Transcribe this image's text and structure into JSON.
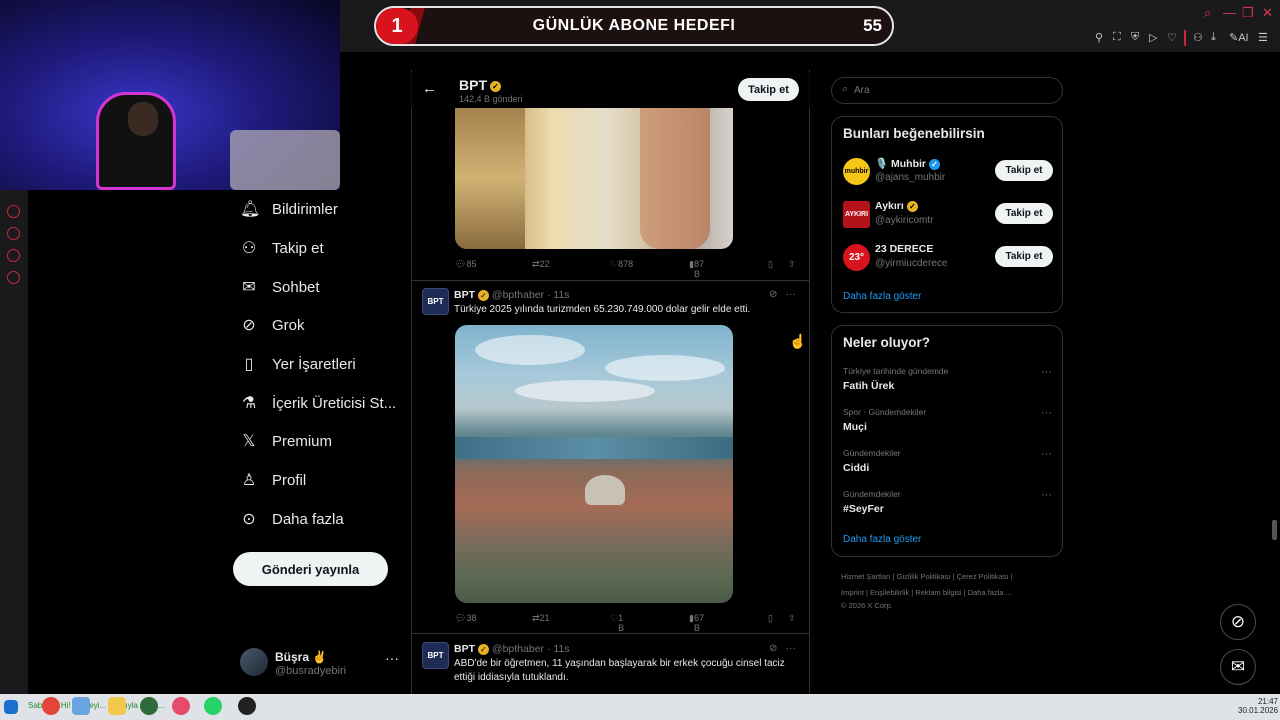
{
  "goal_banner": {
    "rank": "1",
    "title": "GÜNLÜK ABONE HEDEFI",
    "count": "55"
  },
  "browser_toolbar": {
    "ai_label": "AI"
  },
  "nav": [
    {
      "label": "Bildirimler",
      "icon": "bell-icon"
    },
    {
      "label": "Takip et",
      "icon": "person-add-icon"
    },
    {
      "label": "Sohbet",
      "icon": "mail-icon"
    },
    {
      "label": "Grok",
      "icon": "grok-icon"
    },
    {
      "label": "Yer İşaretleri",
      "icon": "bookmark-icon"
    },
    {
      "label": "İçerik Üreticisi St...",
      "icon": "flask-icon"
    },
    {
      "label": "Premium",
      "icon": "x-logo-icon"
    },
    {
      "label": "Profil",
      "icon": "person-icon"
    },
    {
      "label": "Daha fazla",
      "icon": "more-circle-icon"
    }
  ],
  "post_button": "Gönderi yayınla",
  "account": {
    "name": "Büşra ✌️",
    "handle": "@busradyebiri"
  },
  "header": {
    "name": "BPT",
    "subtitle": "142,4 B gönderi",
    "follow": "Takip et"
  },
  "tweets": [
    {
      "stats": {
        "replies": "85",
        "reposts": "22",
        "likes": "878",
        "views": "87 B"
      }
    },
    {
      "name": "BPT",
      "handle": "@bpthaber",
      "time": "· 11s",
      "avatar": "BPT",
      "text": "Türkiye 2025 yılında turizmden 65.230.749.000 dolar gelir elde etti.",
      "stats": {
        "replies": "38",
        "reposts": "21",
        "likes": "1 B",
        "views": "67 B"
      }
    },
    {
      "name": "BPT",
      "handle": "@bpthaber",
      "time": "· 11s",
      "avatar": "BPT",
      "text": "ABD'de bir öğretmen, 11 yaşından başlayarak bir erkek çocuğu cinsel taciz ettiği iddiasıyla tutuklandı."
    }
  ],
  "search": {
    "placeholder": "Ara"
  },
  "suggestions": {
    "title": "Bunları beğenebilirsin",
    "items": [
      {
        "name": "🎙️ Muhbir",
        "handle": "@ajans_muhbir",
        "avatar": "muhbir",
        "button": "Takip et"
      },
      {
        "name": "Aykırı",
        "handle": "@aykiricomtr",
        "avatar": "AYKIRI",
        "button": "Takip et"
      },
      {
        "name": "23 DERECE",
        "handle": "@yirmiucderece",
        "avatar": "23°",
        "button": "Takip et"
      }
    ],
    "show_more": "Daha fazla göster"
  },
  "trends": {
    "title": "Neler oluyor?",
    "items": [
      {
        "context": "Türkiye tarihinde gündemde",
        "topic": "Fatih Ürek"
      },
      {
        "context": "Spor · Gündemdekiler",
        "topic": "Muçi"
      },
      {
        "context": "Gündemdekiler",
        "topic": "Ciddi"
      },
      {
        "context": "Gündemdekiler",
        "topic": "#SeyFer"
      }
    ],
    "show_more": "Daha fazla göster"
  },
  "footer": {
    "line1": "Hizmet Şartları  |  Gizlilik Politikası  |  Çerez Politikası  |",
    "line2": "Imprint  |  Erişilebilirlik  |  Reklam bilgisi  |  Daha fazla ...",
    "line3": "© 2026 X Corp."
  },
  "taskbar": {
    "status": "Sabiyyo: Hi! Bir deyi... felakıyla daha...",
    "time": "21:47",
    "date": "30.01.2026"
  },
  "colors": {
    "accent_red": "#d8131d",
    "link_blue": "#1d9bf0",
    "verified_gold": "#e6b325"
  }
}
